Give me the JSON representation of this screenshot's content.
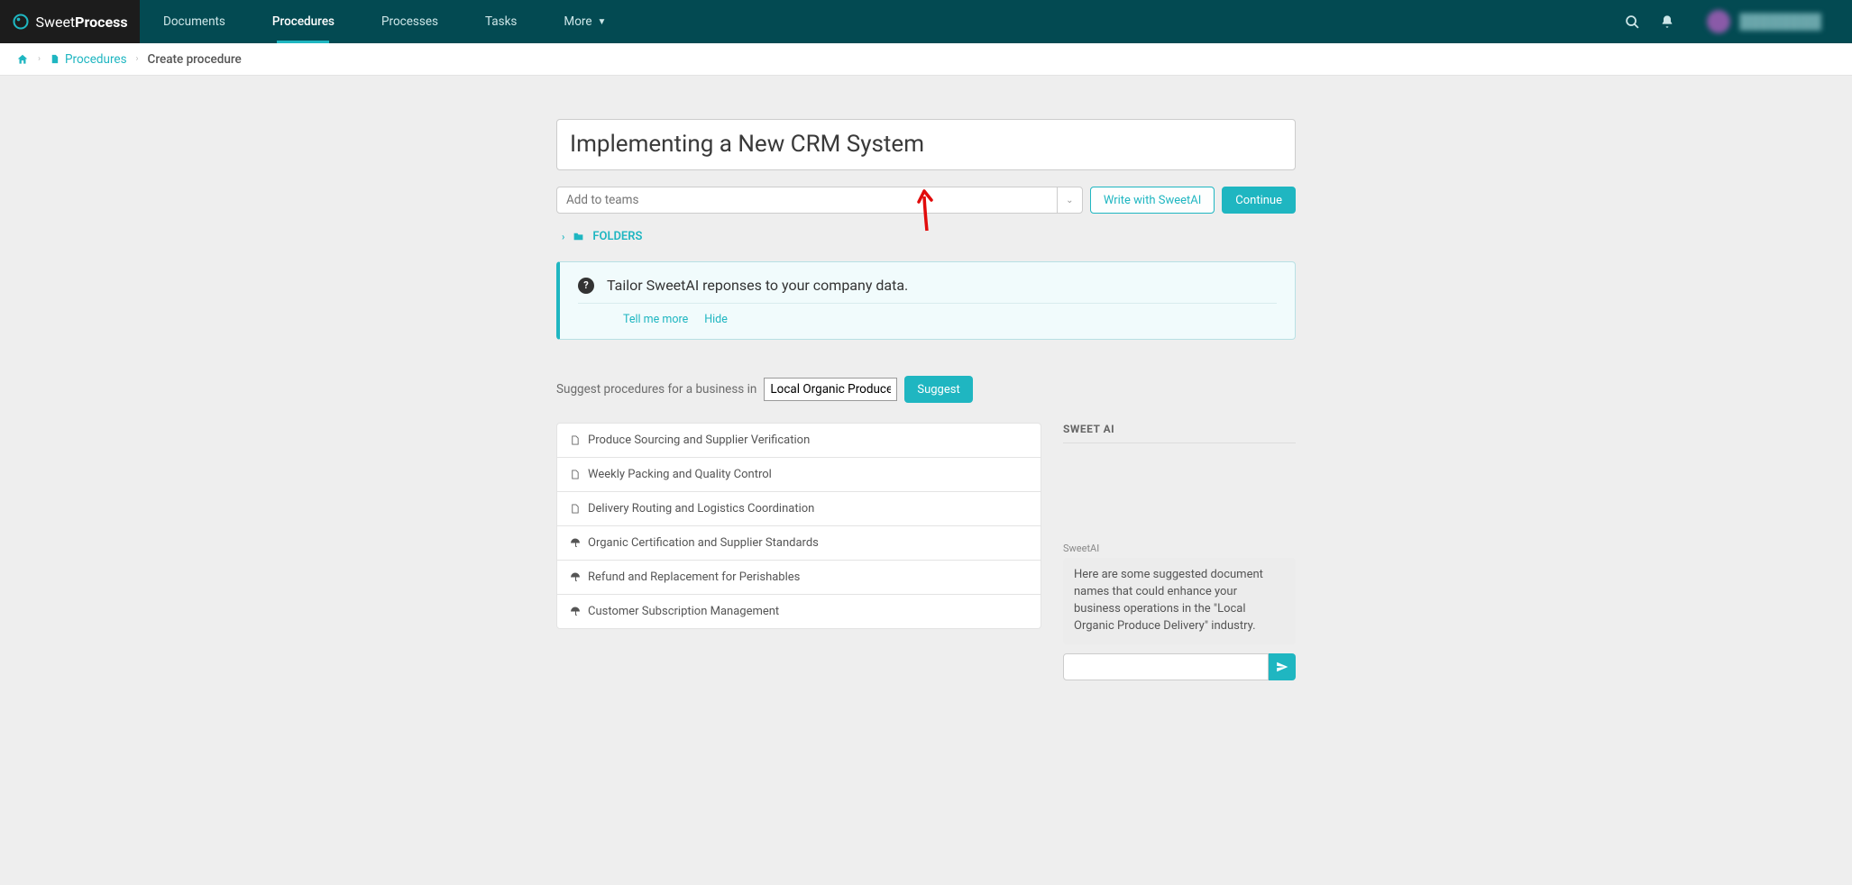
{
  "brand": {
    "logo_text_light": "Sweet",
    "logo_text_bold": "Process"
  },
  "nav": {
    "items": [
      {
        "label": "Documents"
      },
      {
        "label": "Procedures"
      },
      {
        "label": "Processes"
      },
      {
        "label": "Tasks"
      },
      {
        "label": "More"
      }
    ]
  },
  "breadcrumb": {
    "procedures": "Procedures",
    "current": "Create procedure"
  },
  "form": {
    "title": "Implementing a New CRM System",
    "teams_placeholder": "Add to teams",
    "write_ai": "Write with SweetAI",
    "continue": "Continue",
    "folders": "FOLDERS"
  },
  "infobox": {
    "headline": "Tailor SweetAI reponses to your company data.",
    "tell_more": "Tell me more",
    "hide": "Hide"
  },
  "suggest": {
    "prefix": "Suggest procedures for a business in",
    "value": "Local Organic Produce Deli",
    "button": "Suggest"
  },
  "suggestions": [
    {
      "icon": "doc",
      "label": "Produce Sourcing and Supplier Verification"
    },
    {
      "icon": "doc",
      "label": "Weekly Packing and Quality Control"
    },
    {
      "icon": "doc",
      "label": "Delivery Routing and Logistics Coordination"
    },
    {
      "icon": "umbrella",
      "label": "Organic Certification and Supplier Standards"
    },
    {
      "icon": "umbrella",
      "label": "Refund and Replacement for Perishables"
    },
    {
      "icon": "umbrella",
      "label": "Customer Subscription Management"
    }
  ],
  "ai": {
    "title": "SWEET AI",
    "sender": "SweetAI",
    "message": "Here are some suggested document names that could enhance your business operations in the \"Local Organic Produce Delivery\" industry."
  }
}
